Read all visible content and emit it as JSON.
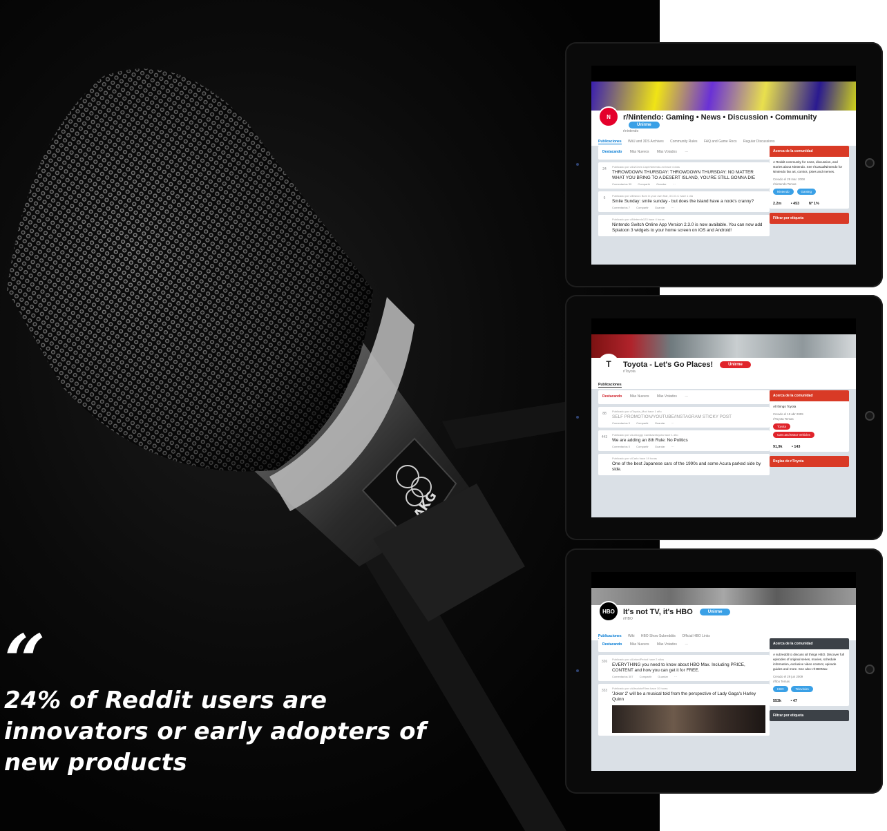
{
  "quote": {
    "mark": "“",
    "text": "24% of Reddit users are innovators or early adopters of new products"
  },
  "microphone_brand": "AKG",
  "colors": {
    "panel_bg": "#0b0b0b",
    "quote_text": "#ffffff",
    "reddit_blue": "#0079d3",
    "nintendo_red": "#d93a26",
    "toyota_red": "#e0242b",
    "hbo_dark": "#3c4147"
  },
  "tablets": [
    {
      "subreddit_title": "r/Nintendo: Gaming • News • Discussion • Community",
      "handle": "r/nintendo",
      "icon_label": "N",
      "join_label": "Unirme",
      "tabs": [
        "Publicaciones",
        "WiiU and 3DS Archives",
        "Community Rules",
        "FAQ and Game Recs",
        "Regular Discussions"
      ],
      "sort": [
        "Destacando",
        "Más Nuevos",
        "Más Votados",
        "···"
      ],
      "posts": [
        {
          "meta": "Publicado por u/DZChris  Capt.Nintendo-ed  hace 4 días",
          "title": "THROWDOWN THURSDAY: THROWDOWN THURSDAY: NO MATTER WHAT YOU BRING TO A DESERT ISLAND, YOU'RE STILL GONNA DIE",
          "votes": "24",
          "actions": [
            "Comentarios 39",
            "Compartir",
            "Guardar",
            "···"
          ]
        },
        {
          "meta": "Publicado por u/Bravo1  Born in your own fear, 3 D.O.C  hace 1 día",
          "title": "Smile Sunday: smile sunday - but does the island have a nook's cranny?",
          "votes": "6",
          "actions": [
            "Comentarios 7",
            "Compartir",
            "Guardar",
            "···"
          ]
        },
        {
          "meta": "Publicado por u/Nintendo123  hace 4 horas",
          "title": "Nintendo Switch Online App Version 2.3.0 is now available. You can now add Splatoon 3 widgets to your home screen on iOS and Android!",
          "votes": "",
          "actions": []
        }
      ],
      "sidebar": {
        "header": "Acerca de la comunidad",
        "about": "A Reddit community for news, discussion, and stories about Nintendo. See r/CasualNintendo for Nintendo fan art, comics, jokes and memes.",
        "created": "Creado el 29 mar. 2008",
        "flair": "r/nintendo Temas",
        "chips": [
          "Nintendo",
          "Gaming"
        ],
        "stats": [
          "2.2m",
          "• 453",
          "Nº 1%"
        ],
        "footer": "Filtrar por etiqueta"
      }
    },
    {
      "subreddit_title": "Toyota - Let's Go Places!",
      "handle": "r/Toyota",
      "icon_label": "T",
      "join_label": "Unirme",
      "tabs": [
        "Publicaciones"
      ],
      "sort": [
        "Destacando",
        "Más Nuevos",
        "Más Votados",
        "···"
      ],
      "posts": [
        {
          "meta": "Publicado por u/Toyota_Mod  hace 1 año",
          "title": "SELF PROMOTION/YOUTUBE/INSTAGRAM STICKY POST",
          "votes": "88",
          "actions": [
            "Comentarios 0",
            "Compartir",
            "Guardar",
            "···"
          ]
        },
        {
          "meta": "Publicado por u/LoDoggy  Camikazetoyota  hace 1 año",
          "title": "We are adding an 8th Rule: No Politics",
          "votes": "443",
          "actions": [
            "Comentarios 0",
            "Compartir",
            "Guardar",
            "···"
          ]
        },
        {
          "meta": "Publicado por u/Carlo  hace 19 horas",
          "title": "One of the best Japanese cars of the 1990s and some Acura parked side by side.",
          "votes": "",
          "actions": []
        }
      ],
      "sidebar": {
        "header": "Acerca de la comunidad",
        "about": "All things Toyota",
        "created": "Creado el 19 abr 2009",
        "flair": "r/Toyota Temas",
        "chips": [
          "Toyota",
          "Cars and Motor Vehicles"
        ],
        "stats": [
          "91,9k",
          "• 143"
        ],
        "footer": "Reglas de r/Toyota"
      }
    },
    {
      "subreddit_title": "It's not TV, it's HBO",
      "handle": "r/HBO",
      "icon_label": "HBO",
      "join_label": "Unirme",
      "tabs": [
        "Publicaciones",
        "Wiki",
        "HBO Show Subreddits",
        "Official HBO Links"
      ],
      "sort": [
        "Destacando",
        "Más Nuevos",
        "Más Votados",
        "···"
      ],
      "posts": [
        {
          "meta": "Publicado por u/LinkedPeriod  hace 2 años",
          "title": "EVERYTHING you need to know about HBO Max. Including PRICE, CONTENT and how you can get it for FREE.",
          "votes": "326",
          "actions": [
            "Comentarios 307",
            "Compartir",
            "Guardar",
            "···"
          ]
        },
        {
          "meta": "Publicado por u/AbsoluteFilms  hace 10 horas",
          "title": "'Joker 2' will be a musical told from the perspective of Lady Gaga's Harley Quinn",
          "votes": "333",
          "actions": []
        }
      ],
      "sidebar": {
        "header": "Acerca de la comunidad",
        "about": "A subreddit to discuss all things HBO. Discover full episodes of original series, movies, schedule information, exclusive video content, episode guides and more. See also: r/HBOMax",
        "created": "Creado el 29 jun 2009",
        "flair": "r/hbo Temas",
        "chips": [
          "HBO",
          "Television"
        ],
        "stats": [
          "553k",
          "• 47"
        ],
        "footer": "Filtrar por etiqueta"
      }
    }
  ]
}
